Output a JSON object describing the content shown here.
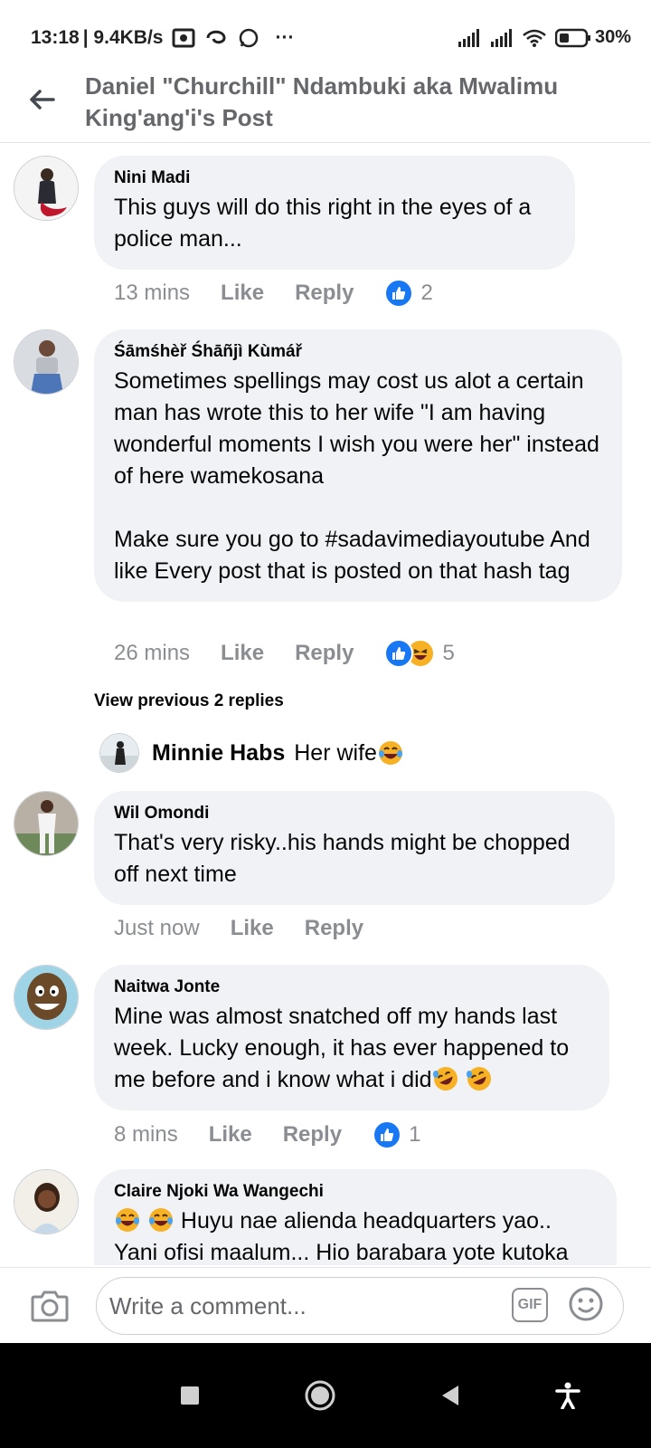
{
  "status_bar": {
    "time": "13:18",
    "speed": "| 9.4KB/s",
    "more": "···",
    "battery": "30%",
    "icons": [
      "image-icon",
      "swirl-icon",
      "whatsapp-icon",
      "signal-icon",
      "signal-icon",
      "wifi-icon",
      "battery-icon"
    ]
  },
  "header": {
    "title": "Daniel \"Churchill\" Ndambuki aka Mwalimu King'ang'i's Post",
    "back_icon": "back-arrow-icon"
  },
  "comments": [
    {
      "name": "Nini Madi",
      "text": "This guys will do this right in the eyes of a police man...",
      "time": "13 mins",
      "like": "Like",
      "reply": "Reply",
      "reactions": [
        "like"
      ],
      "count": "2"
    },
    {
      "name": "Śāmśhèř Śhāñjì Kùmář",
      "text": "Sometimes spellings may cost us alot a certain man has wrote this to her wife \"I am having wonderful moments I wish you were her\" instead of here wamekosana\n\nMake sure you go to #sadavimediayoutube And like Every post that is posted on that hash tag",
      "time": "26 mins",
      "like": "Like",
      "reply": "Reply",
      "reactions": [
        "like",
        "haha"
      ],
      "count": "5"
    },
    {
      "name": "Wil Omondi",
      "text": "That's very risky..his hands might be chopped off next time",
      "time": "Just now",
      "like": "Like",
      "reply": "Reply"
    },
    {
      "name": "Naitwa Jonte",
      "text": "Mine was almost snatched off my hands last week. Lucky enough, it has ever happened to me before and i know what i did",
      "time": "8 mins",
      "like": "Like",
      "reply": "Reply",
      "reactions": [
        "like"
      ],
      "count": "1"
    },
    {
      "name": "Claire Njoki Wa Wangechi",
      "text": " Huyu nae alienda headquarters yao.. Yani ofisi maalum... Hio barabara yote kutoka"
    }
  ],
  "view_previous": "View previous 2 replies",
  "reply_preview": {
    "name": "Minnie Habs",
    "text": "Her wife"
  },
  "composer": {
    "placeholder": "Write a comment...",
    "gif_label": "GIF"
  },
  "colors": {
    "bubble": "#f0f2f5",
    "meta_gray": "#8a8d91",
    "like_blue": "#1877f2",
    "emoji_yellow": "#f7b125"
  }
}
